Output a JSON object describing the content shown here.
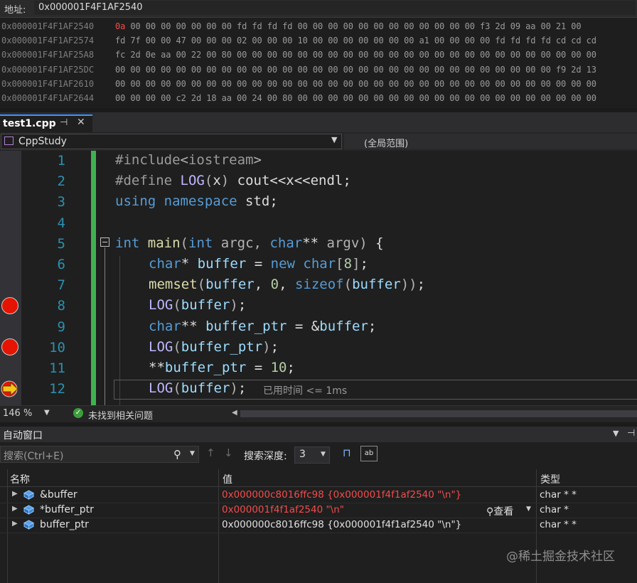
{
  "memory": {
    "address_label": "地址:",
    "address_value": "0x000001F4F1AF2540",
    "rows": [
      {
        "addr": "0x000001F4F1AF2540",
        "first": "0a",
        "rest": " 00 00 00 00 00 00 00 fd fd fd fd 00 00 00 00 00 00 00 00 00 00 00 00 f3 2d 09 aa 00 21 00"
      },
      {
        "addr": "0x000001F4F1AF2574",
        "first": "",
        "rest": "fd 7f 00 00 47 00 00 00 02 00 00 00 10 00 00 00 00 00 00 00 a1 00 00 00 00 fd fd fd fd cd cd cd"
      },
      {
        "addr": "0x000001F4F1AF25A8",
        "first": "",
        "rest": "fc 2d 0e aa 00 22 00 80 00 00 00 00 00 00 00 00 00 00 00 00 00 00 00 00 00 00 00 00 00 00 00 00"
      },
      {
        "addr": "0x000001F4F1AF25DC",
        "first": "",
        "rest": "00 00 00 00 00 00 00 00 00 00 00 00 00 00 00 00 00 00 00 00 00 00 00 00 00 00 00 00 00 f9 2d 13"
      },
      {
        "addr": "0x000001F4F1AF2610",
        "first": "",
        "rest": "00 00 00 00 00 00 00 00 00 00 00 00 00 00 00 00 00 00 00 00 00 00 00 00 00 00 00 00 00 00 00 00"
      },
      {
        "addr": "0x000001F4F1AF2644",
        "first": "",
        "rest": "00 00 00 00 c2 2d 18 aa 00 24 00 80 00 00 00 00 00 00 00 00 00 00 00 00 00 00 00 00 00 00 00 00"
      }
    ]
  },
  "tab": {
    "label": "test1.cpp",
    "pin": "⊣",
    "close": "✕"
  },
  "nav": {
    "project": "CppStudy",
    "scope": "(全局范围)"
  },
  "editor": {
    "line_numbers": [
      "1",
      "2",
      "3",
      "4",
      "5",
      "6",
      "7",
      "8",
      "9",
      "10",
      "11",
      "12"
    ],
    "breakpoints": [
      "8",
      "10"
    ],
    "current_line": "12",
    "perf_tip": "已用时间 <= 1ms"
  },
  "status": {
    "zoom": "146 %",
    "issues": "未找到相关问题"
  },
  "autos": {
    "title": "自动窗口",
    "search_placeholder": "搜索(Ctrl+E)",
    "depth_label": "搜索深度:",
    "depth_value": "3",
    "columns": {
      "name": "名称",
      "value": "值",
      "type": "类型"
    },
    "rows": [
      {
        "name": "&buffer",
        "value": "0x000000c8016ffc98 {0x000001f4f1af2540 \"\\n\"}",
        "type": "char * *",
        "changed": true
      },
      {
        "name": "*buffer_ptr",
        "value": "0x000001f4f1af2540 \"\\n\"",
        "type": "char *",
        "changed": true
      },
      {
        "name": "buffer_ptr",
        "value": "0x000000c8016ffc98 {0x000001f4f1af2540 \"\\n\"}",
        "type": "char * *",
        "changed": false
      }
    ],
    "view_label": "查看"
  },
  "watermark": "@稀土掘金技术社区",
  "colors": {
    "accent": "#3794ff",
    "breakpoint": "#e51400",
    "changed_value": "#f14c4c",
    "change_bar": "#3fb24f"
  }
}
